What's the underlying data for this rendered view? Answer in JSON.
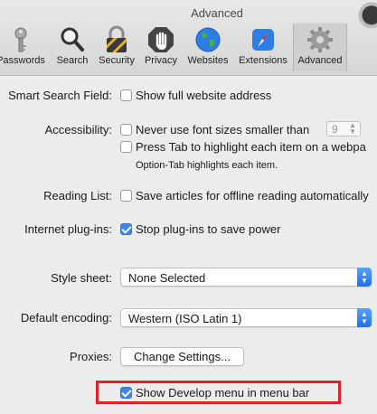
{
  "window": {
    "title": "Advanced"
  },
  "tabs": [
    {
      "label": "Passwords",
      "icon": "key-icon"
    },
    {
      "label": "Search",
      "icon": "magnifier-icon"
    },
    {
      "label": "Security",
      "icon": "padlock-icon"
    },
    {
      "label": "Privacy",
      "icon": "hand-icon"
    },
    {
      "label": "Websites",
      "icon": "globe-icon"
    },
    {
      "label": "Extensions",
      "icon": "compass-icon"
    },
    {
      "label": "Advanced",
      "icon": "gear-icon",
      "active": true
    }
  ],
  "smart_search": {
    "label": "Smart Search Field:",
    "option": "Show full website address",
    "checked": false
  },
  "accessibility": {
    "label": "Accessibility:",
    "option1": "Never use font sizes smaller than",
    "font_size": "9",
    "option2": "Press Tab to highlight each item on a webpa",
    "note": "Option-Tab highlights each item."
  },
  "reading_list": {
    "label": "Reading List:",
    "option": "Save articles for offline reading automatically"
  },
  "plugins": {
    "label": "Internet plug-ins:",
    "option": "Stop plug-ins to save power",
    "checked": true
  },
  "style_sheet": {
    "label": "Style sheet:",
    "value": "None Selected"
  },
  "encoding": {
    "label": "Default encoding:",
    "value": "Western (ISO Latin 1)"
  },
  "proxies": {
    "label": "Proxies:",
    "button": "Change Settings..."
  },
  "develop": {
    "option": "Show Develop menu in menu bar",
    "checked": true
  },
  "colors": {
    "accent": "#3b86f0",
    "highlight_border": "#e0202a"
  }
}
